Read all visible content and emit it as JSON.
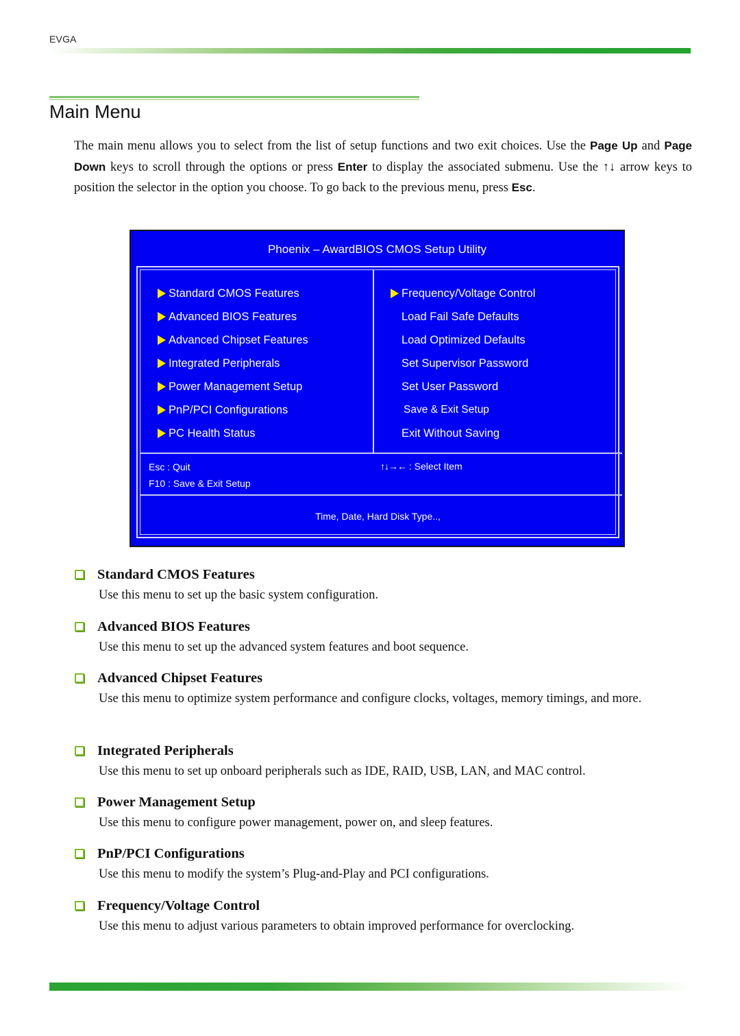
{
  "header": {
    "brand": "EVGA"
  },
  "page_title": "Main Menu",
  "intro": {
    "part1": "The main menu allows you to select from the list of setup functions and two exit choices. Use the ",
    "key_pageup": "Page Up",
    "part2": " and ",
    "key_pagedown": "Page Down",
    "part3": " keys to scroll through the options or press ",
    "key_enter": "Enter",
    "part4": " to display the associated submenu. Use the ",
    "arrows": "↑↓",
    "part5": " arrow keys to position the selector in the option you choose. To go back to the previous menu, press ",
    "key_esc": "Esc",
    "part6": "."
  },
  "bios": {
    "title": "Phoenix – AwardBIOS CMOS Setup Utility",
    "left_menu": [
      "Standard CMOS Features",
      "Advanced BIOS Features",
      "Advanced Chipset Features",
      "Integrated Peripherals",
      "Power Management Setup",
      "PnP/PCI Configurations",
      "PC Health Status"
    ],
    "right_menu": [
      {
        "label": "Frequency/Voltage Control",
        "submenu": true
      },
      {
        "label": "Load Fail Safe Defaults",
        "submenu": false
      },
      {
        "label": "Load Optimized Defaults",
        "submenu": false
      },
      {
        "label": "Set Supervisor Password",
        "submenu": false
      },
      {
        "label": "Set User Password",
        "submenu": false
      },
      {
        "label": "Save & Exit Setup",
        "submenu": false
      },
      {
        "label": "Exit Without Saving",
        "submenu": false
      }
    ],
    "hint_esc": "Esc : Quit",
    "hint_f10": "F10 : Save & Exit Setup",
    "hint_select_glyph": "↑↓→←",
    "hint_select_text": " : Select Item",
    "help_text": "Time, Date, Hard Disk Type..,",
    "colors": {
      "background": "#0000f2",
      "arrow": "#ffe800",
      "text": "#ffffff"
    }
  },
  "sections": [
    {
      "title": "Standard CMOS Features",
      "desc": "Use this menu to set up the basic system configuration."
    },
    {
      "title": "Advanced BIOS Features",
      "desc": "Use this menu to set up the advanced system features and boot sequence."
    },
    {
      "title": "Advanced Chipset Features",
      "desc": "Use this menu to optimize system performance and configure clocks, voltages, memory timings, and more."
    },
    {
      "title": "Integrated Peripherals",
      "desc": "Use this menu to set up onboard peripherals such as IDE, RAID, USB, LAN, and MAC control."
    },
    {
      "title": "Power Management Setup",
      "desc": "Use this menu to configure power management, power on, and sleep features."
    },
    {
      "title": "PnP/PCI Configurations",
      "desc": "Use this menu to modify the system’s Plug-and-Play and PCI configurations."
    },
    {
      "title": "Frequency/Voltage Control",
      "desc": "Use this menu to adjust various parameters to obtain improved performance for overclocking."
    }
  ],
  "theme": {
    "accent_green": "#2aa434",
    "checkbox_green": "#7dbb2a"
  }
}
